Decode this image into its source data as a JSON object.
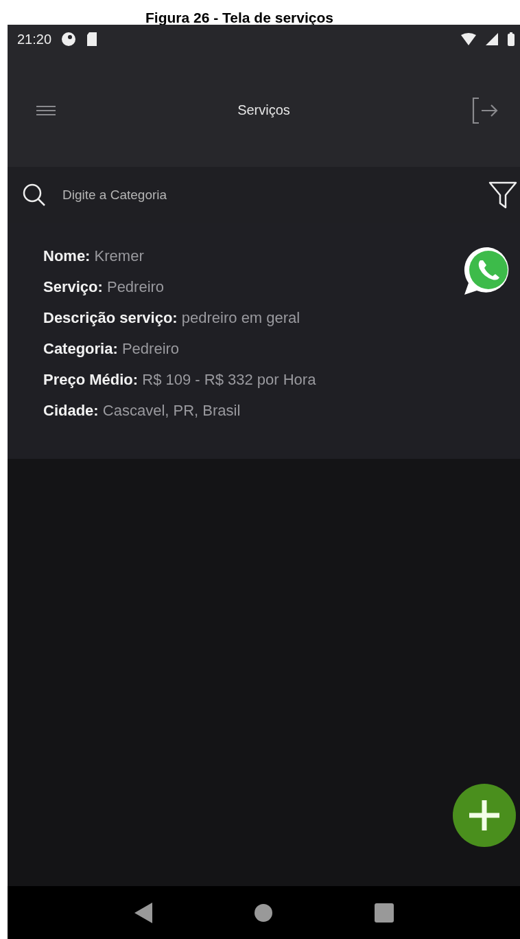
{
  "caption": "Figura 26 - Tela de serviços",
  "status_bar": {
    "time": "21:20"
  },
  "app_bar": {
    "title": "Serviços"
  },
  "search": {
    "placeholder": "Digite a Categoria"
  },
  "services": [
    {
      "fields": [
        {
          "label": "Nome:",
          "value": "Kremer"
        },
        {
          "label": "Serviço:",
          "value": "Pedreiro"
        },
        {
          "label": "Descrição serviço:",
          "value": "pedreiro em geral"
        },
        {
          "label": "Categoria:",
          "value": "Pedreiro"
        },
        {
          "label": "Preço Médio:",
          "value": "R$ 109 - R$ 332 por Hora"
        },
        {
          "label": "Cidade:",
          "value": "Cascavel, PR, Brasil"
        }
      ]
    }
  ]
}
